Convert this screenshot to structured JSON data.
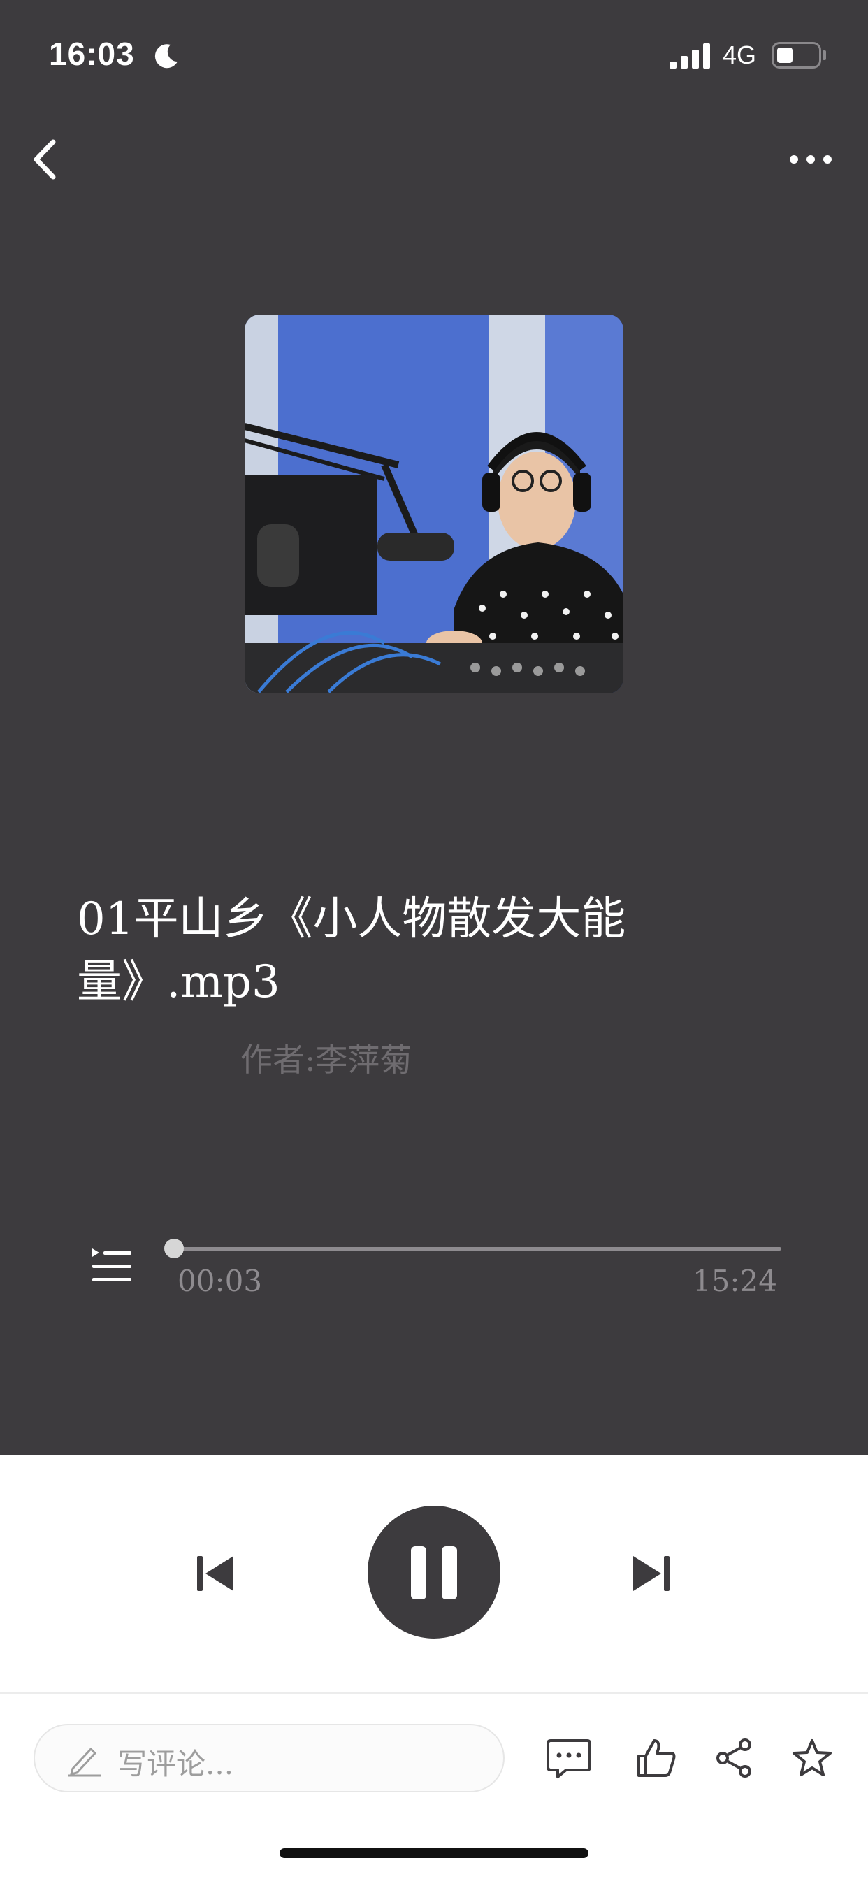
{
  "status_bar": {
    "time": "16:03",
    "network": "4G"
  },
  "track": {
    "title": "01平山乡《小人物散发大能量》.mp3",
    "author": "作者:李萍菊"
  },
  "playback": {
    "current_time": "00:03",
    "total_time": "15:24",
    "progress_fraction": 0.0032
  },
  "comment": {
    "placeholder": "写评论..."
  },
  "icons": {
    "back": "chevron-left-icon",
    "more": "ellipsis-icon",
    "playlist": "playlist-icon",
    "previous": "skip-previous-icon",
    "pause": "pause-icon",
    "next": "skip-next-icon",
    "comment": "comment-bubble-icon",
    "like": "thumbs-up-icon",
    "share": "share-icon",
    "favorite": "star-icon"
  },
  "colors": {
    "background_dark": "#3d3b3e",
    "text_white": "#ffffff",
    "muted": "#8e8b8f"
  }
}
